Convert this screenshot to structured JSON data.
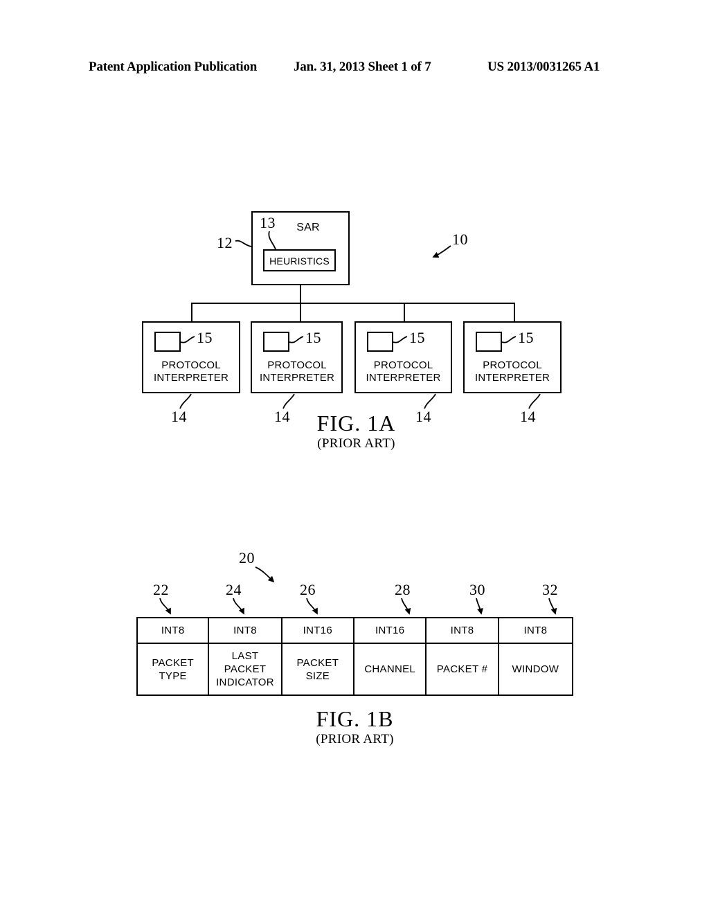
{
  "header": {
    "left": "Patent Application Publication",
    "middle": "Jan. 31, 2013  Sheet 1 of 7",
    "right": "US 2013/0031265 A1"
  },
  "fig1a": {
    "caption_title": "FIG. 1A",
    "caption_sub": "(PRIOR ART)",
    "system_ref": "10",
    "sar": {
      "title": "SAR",
      "ref": "12",
      "heuristics_label": "HEURISTICS",
      "heuristics_ref": "13"
    },
    "interpreters": [
      {
        "label": "PROTOCOL\nINTERPRETER",
        "inner_ref": "15",
        "ref": "14"
      },
      {
        "label": "PROTOCOL\nINTERPRETER",
        "inner_ref": "15",
        "ref": "14"
      },
      {
        "label": "PROTOCOL\nINTERPRETER",
        "inner_ref": "15",
        "ref": "14"
      },
      {
        "label": "PROTOCOL\nINTERPRETER",
        "inner_ref": "15",
        "ref": "14"
      }
    ]
  },
  "fig1b": {
    "caption_title": "FIG. 1B",
    "caption_sub": "(PRIOR ART)",
    "packet_ref": "20",
    "fields": [
      {
        "type": "INT8",
        "name": "PACKET\nTYPE",
        "ref": "22"
      },
      {
        "type": "INT8",
        "name": "LAST\nPACKET\nINDICATOR",
        "ref": "24"
      },
      {
        "type": "INT16",
        "name": "PACKET\nSIZE",
        "ref": "26"
      },
      {
        "type": "INT16",
        "name": "CHANNEL",
        "ref": "28"
      },
      {
        "type": "INT8",
        "name": "PACKET #",
        "ref": "30"
      },
      {
        "type": "INT8",
        "name": "WINDOW",
        "ref": "32"
      }
    ]
  }
}
